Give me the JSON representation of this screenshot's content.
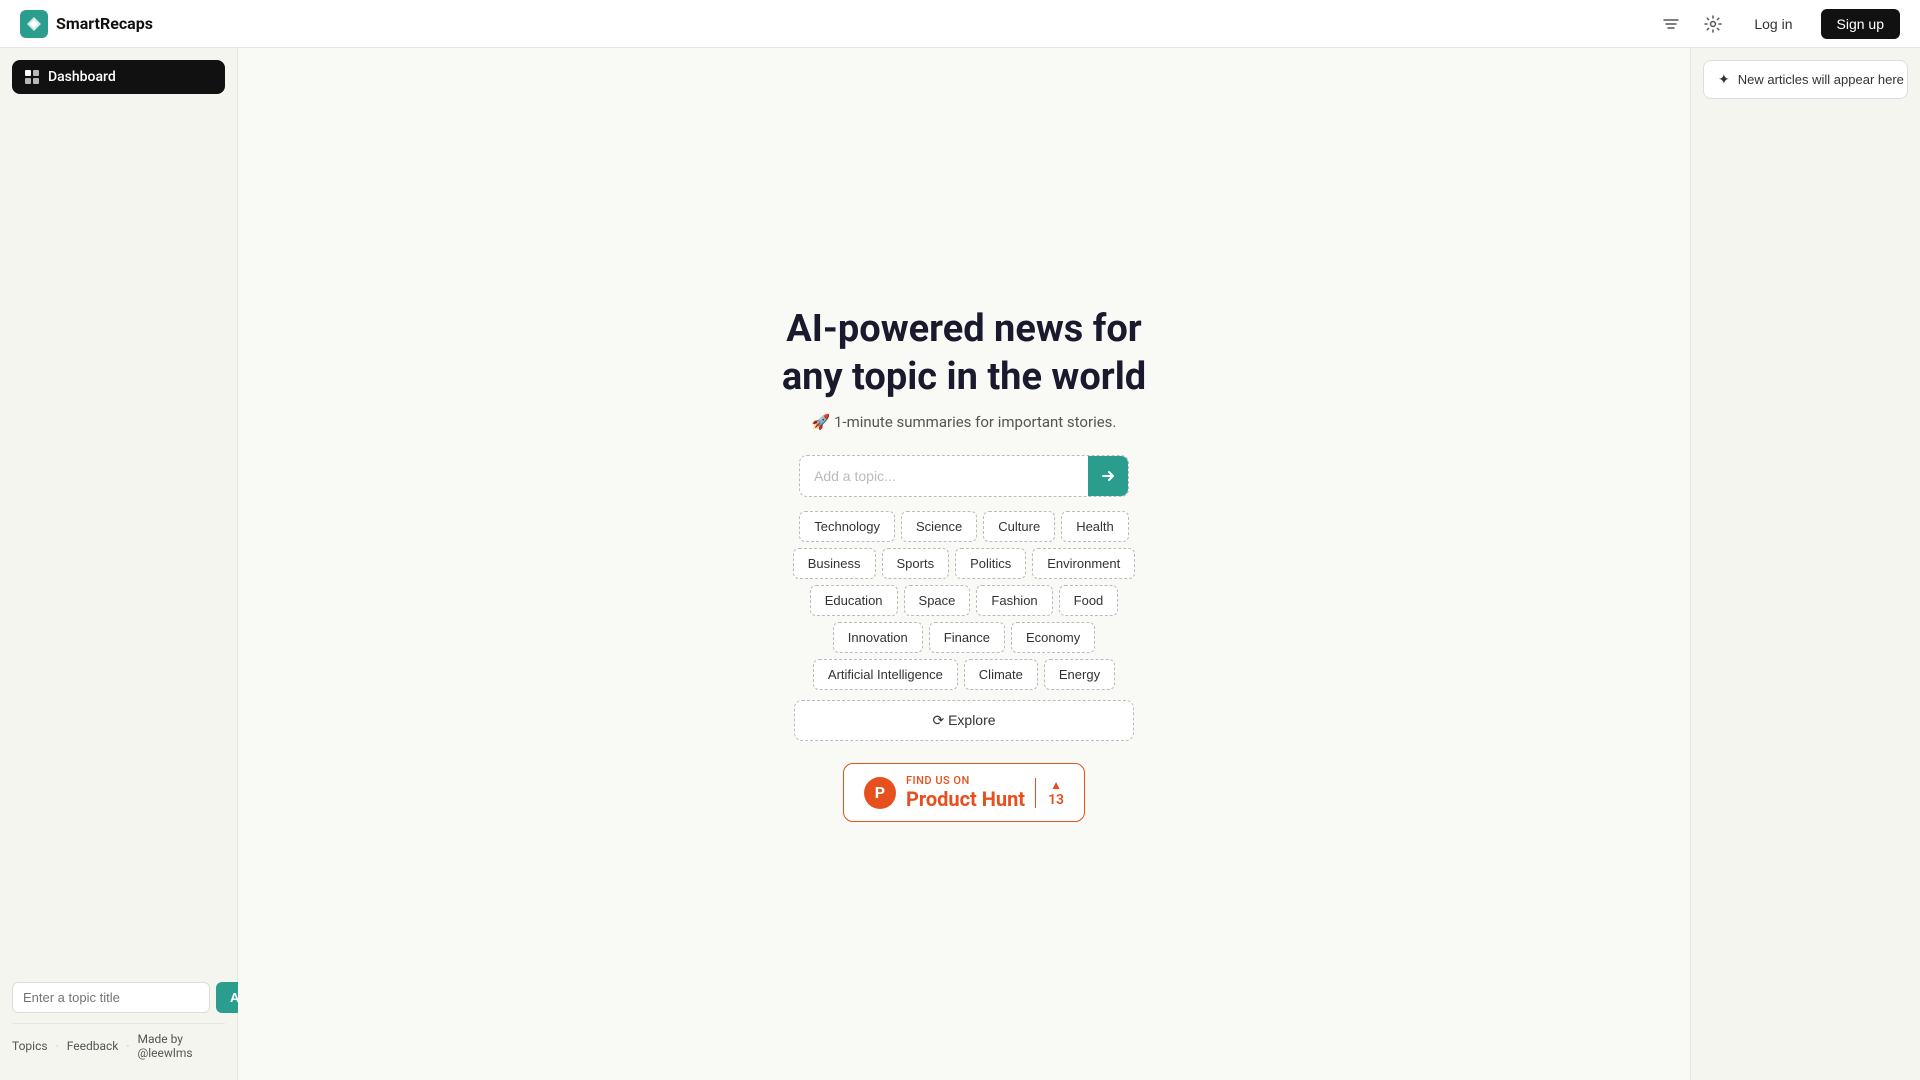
{
  "app": {
    "name": "SmartRecaps"
  },
  "header": {
    "logo_text": "SmartRecaps",
    "icons": {
      "filter": "filter-icon",
      "settings": "settings-icon"
    },
    "login_label": "Log in",
    "signup_label": "Sign up"
  },
  "sidebar": {
    "dashboard_label": "Dashboard",
    "input_placeholder": "Enter a topic title",
    "add_button_label": "Add",
    "links": [
      {
        "label": "Topics"
      },
      {
        "label": "Feedback"
      },
      {
        "label": "Made by @leewlms"
      }
    ]
  },
  "main": {
    "title_line1": "AI-powered news for",
    "title_line2": "any topic in the world",
    "subtitle": "🚀 1-minute summaries for important stories.",
    "search_placeholder": "Add a topic...",
    "search_button_label": "→",
    "topics": [
      [
        "Technology",
        "Science",
        "Culture",
        "Health"
      ],
      [
        "Business",
        "Sports",
        "Politics",
        "Environment"
      ],
      [
        "Education",
        "Space",
        "Fashion",
        "Food"
      ],
      [
        "Innovation",
        "Finance",
        "Economy"
      ],
      [
        "Artificial Intelligence",
        "Climate",
        "Energy"
      ]
    ],
    "explore_label": "⟳ Explore"
  },
  "product_hunt": {
    "find_us_label": "FIND US ON",
    "name": "Product Hunt",
    "count": "13"
  },
  "right_panel": {
    "new_articles_label": "New articles will appear here"
  }
}
